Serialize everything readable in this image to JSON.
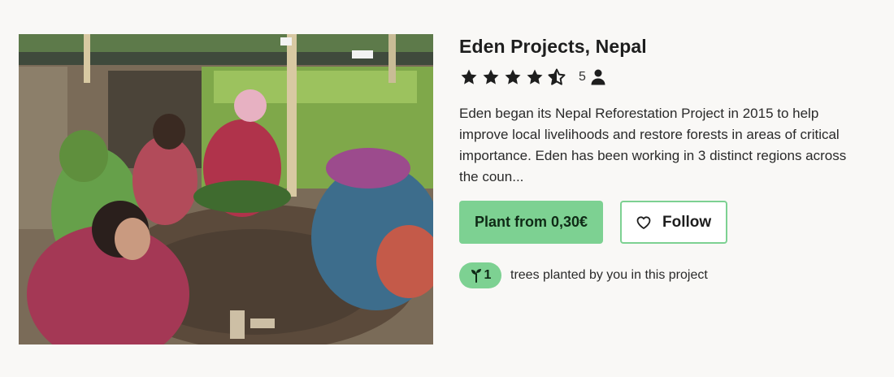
{
  "project": {
    "title": "Eden Projects, Nepal",
    "rating": 4.5,
    "rating_icon": "star-icon",
    "reviewer_count": "5",
    "reviewer_icon": "person-icon",
    "description": "Eden began its Nepal Reforestation Project in 2015 to help improve local livelihoods and restore forests in areas of critical importance. Eden has been working in 3 distinct regions across the coun..."
  },
  "actions": {
    "plant_label": "Plant from 0,30€",
    "follow_label": "Follow",
    "follow_icon": "heart-outline-icon"
  },
  "planted": {
    "count": "1",
    "icon": "sapling-icon",
    "text": "trees planted by you in this project"
  },
  "colors": {
    "accent": "#7dd192",
    "background": "#f9f8f6",
    "text": "#1e1e1e"
  }
}
